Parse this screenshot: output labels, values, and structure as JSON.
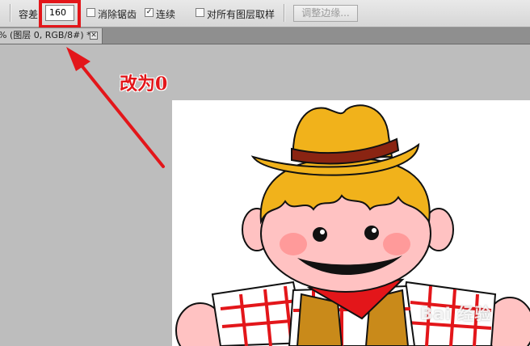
{
  "options_bar": {
    "tolerance_label": "容差",
    "tolerance_value": "160",
    "anti_alias_label": "消除锯齿",
    "anti_alias_checked": false,
    "contiguous_label": "连续",
    "contiguous_checked": true,
    "sample_all_layers_label": "对所有图层取样",
    "sample_all_layers_checked": false,
    "refine_edge_label": "调整边缘..."
  },
  "document_tab": {
    "title": "% (图层 0, RGB/8#) *",
    "close_glyph": "✕"
  },
  "annotation": {
    "text": "改为0",
    "color": "#e3161a"
  },
  "watermark": {
    "text": "Bai 经验"
  },
  "icons": {
    "check_mark": "✓"
  }
}
